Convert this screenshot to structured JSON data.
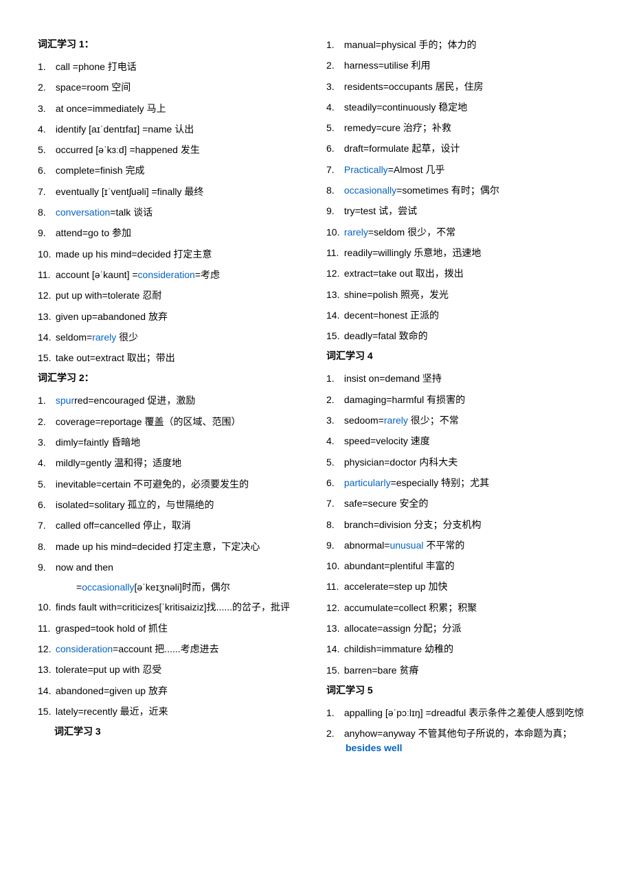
{
  "left": {
    "s1": {
      "title": "词汇学习 1：",
      "items": [
        {
          "n": "1.",
          "parts": [
            {
              "t": "call =phone  打电话"
            }
          ]
        },
        {
          "n": "2.",
          "parts": [
            {
              "t": "space=room 空间"
            }
          ]
        },
        {
          "n": "3.",
          "parts": [
            {
              "t": "at once=immediately  马上"
            }
          ]
        },
        {
          "n": "4.",
          "parts": [
            {
              "t": "identify [aɪˈdentɪfaɪ] =name 认出"
            }
          ]
        },
        {
          "n": "5.",
          "parts": [
            {
              "t": "occurred [əˈkɜːd] =happened 发生"
            }
          ]
        },
        {
          "n": "6.",
          "parts": [
            {
              "t": "complete=finish 完成"
            }
          ]
        },
        {
          "n": "7.",
          "parts": [
            {
              "t": "eventually [ɪˈventʃuəli] =finally 最终"
            }
          ]
        },
        {
          "n": "8.",
          "parts": [
            {
              "t": "conversation",
              "c": "link"
            },
            {
              "t": "=talk 谈话"
            }
          ]
        },
        {
          "n": "9.",
          "parts": [
            {
              "t": "attend=go to 参加"
            }
          ]
        },
        {
          "n": "10.",
          "parts": [
            {
              "t": "made up his mind=decided 打定主意"
            }
          ]
        },
        {
          "n": "11.",
          "parts": [
            {
              "t": "account [əˈkaʊnt] ="
            },
            {
              "t": "consideration",
              "c": "link"
            },
            {
              "t": "=考虑"
            }
          ]
        },
        {
          "n": "12.",
          "parts": [
            {
              "t": "put up with=tolerate 忍耐"
            }
          ]
        },
        {
          "n": "13.",
          "parts": [
            {
              "t": "given up=abandoned 放弃"
            }
          ]
        },
        {
          "n": "14.",
          "parts": [
            {
              "t": "seldom="
            },
            {
              "t": "rarely",
              "c": "link"
            },
            {
              "t": " 很少"
            }
          ]
        },
        {
          "n": "15.",
          "parts": [
            {
              "t": "take out=extract 取出；带出"
            }
          ]
        }
      ]
    },
    "s2": {
      "title": "词汇学习 2：",
      "items": [
        {
          "n": "1.",
          "parts": [
            {
              "t": "spur",
              "c": "link"
            },
            {
              "t": "red=encouraged 促进，激励"
            }
          ]
        },
        {
          "n": "2.",
          "parts": [
            {
              "t": "coverage=reportage 覆盖（的区域、范围）"
            }
          ]
        },
        {
          "n": "3.",
          "parts": [
            {
              "t": "dimly=faintly 昏暗地"
            }
          ]
        },
        {
          "n": "4.",
          "parts": [
            {
              "t": "mildly=gently 温和得；适度地"
            }
          ]
        },
        {
          "n": "5.",
          "parts": [
            {
              "t": "inevitable=certain 不可避免的，必须要发生的"
            }
          ]
        },
        {
          "n": "6.",
          "parts": [
            {
              "t": "isolated=solitary 孤立的，与世隔绝的"
            }
          ]
        },
        {
          "n": "7.",
          "parts": [
            {
              "t": "called off=cancelled 停止，取消"
            }
          ]
        },
        {
          "n": "8.",
          "parts": [
            {
              "t": "made up his mind=decided 打定主意，下定决心"
            }
          ]
        },
        {
          "n": "9.",
          "parts": [
            {
              "t": "now and then"
            }
          ],
          "sub": [
            {
              "t": "=",
              "c": ""
            },
            {
              "t": "occasionally",
              "c": "link"
            },
            {
              "t": "[əˈkeɪʒnəli]时而，偶尔"
            }
          ]
        },
        {
          "n": "10.",
          "parts": [
            {
              "t": "finds fault with=criticizes[ˈkritisaiziz]找......的岔子，批评"
            }
          ]
        },
        {
          "n": "11.",
          "parts": [
            {
              "t": "grasped=took hold of 抓住"
            }
          ]
        },
        {
          "n": "12.",
          "parts": [
            {
              "t": "consideration",
              "c": "link"
            },
            {
              "t": "=account 把......考虑进去"
            }
          ]
        },
        {
          "n": "13.",
          "parts": [
            {
              "t": "tolerate=put up with 忍受"
            }
          ]
        },
        {
          "n": "14.",
          "parts": [
            {
              "t": "abandoned=given up 放弃"
            }
          ]
        },
        {
          "n": "15.",
          "parts": [
            {
              "t": "lately=recently 最近，近来"
            }
          ]
        }
      ]
    },
    "s3": {
      "title": "词汇学习 3"
    }
  },
  "right": {
    "s3items": [
      {
        "n": "1.",
        "parts": [
          {
            "t": "manual=physical 手的；体力的"
          }
        ]
      },
      {
        "n": "2.",
        "parts": [
          {
            "t": "harness=utilise 利用"
          }
        ]
      },
      {
        "n": "3.",
        "parts": [
          {
            "t": "residents=occupants 居民，住房"
          }
        ]
      },
      {
        "n": "4.",
        "parts": [
          {
            "t": "steadily=continuously 稳定地"
          }
        ]
      },
      {
        "n": "5.",
        "parts": [
          {
            "t": "remedy=cure 治疗；补救"
          }
        ]
      },
      {
        "n": "6.",
        "parts": [
          {
            "t": "draft=formulate 起草，设计"
          }
        ]
      },
      {
        "n": "7.",
        "parts": [
          {
            "t": "Practically",
            "c": "link"
          },
          {
            "t": "=Almost 几乎"
          }
        ]
      },
      {
        "n": "8.",
        "parts": [
          {
            "t": "occasionally",
            "c": "link"
          },
          {
            "t": "=sometimes 有时；偶尔"
          }
        ]
      },
      {
        "n": "9.",
        "parts": [
          {
            "t": "try=test 试，尝试"
          }
        ]
      },
      {
        "n": "10.",
        "parts": [
          {
            "t": "rarely",
            "c": "link"
          },
          {
            "t": "=seldom 很少，不常"
          }
        ]
      },
      {
        "n": "11.",
        "parts": [
          {
            "t": "readily=willingly 乐意地，迅速地"
          }
        ]
      },
      {
        "n": "12.",
        "parts": [
          {
            "t": "extract=take out 取出，拨出"
          }
        ]
      },
      {
        "n": "13.",
        "parts": [
          {
            "t": "shine=polish 照亮，发光"
          }
        ]
      },
      {
        "n": "14.",
        "parts": [
          {
            "t": "decent=honest 正派的"
          }
        ]
      },
      {
        "n": "15.",
        "parts": [
          {
            "t": "deadly=fatal 致命的"
          }
        ]
      }
    ],
    "s4": {
      "title": "词汇学习 4",
      "items": [
        {
          "n": "1.",
          "parts": [
            {
              "t": "insist on=demand 坚持"
            }
          ]
        },
        {
          "n": "2.",
          "parts": [
            {
              "t": "damaging=harmful 有损害的"
            }
          ]
        },
        {
          "n": "3.",
          "parts": [
            {
              "t": "sedoom="
            },
            {
              "t": "rarely",
              "c": "link"
            },
            {
              "t": " 很少；不常"
            }
          ]
        },
        {
          "n": "4.",
          "parts": [
            {
              "t": "speed=velocity 速度"
            }
          ]
        },
        {
          "n": "5.",
          "parts": [
            {
              "t": "physician=doctor 内科大夫"
            }
          ]
        },
        {
          "n": "6.",
          "parts": [
            {
              "t": "particularly",
              "c": "link"
            },
            {
              "t": "=especially 特别；尤其"
            }
          ]
        },
        {
          "n": "7.",
          "parts": [
            {
              "t": "safe=secure 安全的"
            }
          ]
        },
        {
          "n": "8.",
          "parts": [
            {
              "t": "branch=division 分支；分支机构"
            }
          ]
        },
        {
          "n": "9.",
          "parts": [
            {
              "t": "abnormal="
            },
            {
              "t": "unusual",
              "c": "link"
            },
            {
              "t": " 不平常的"
            }
          ]
        },
        {
          "n": "10.",
          "parts": [
            {
              "t": "abundant=plentiful 丰富的"
            }
          ]
        },
        {
          "n": "11.",
          "parts": [
            {
              "t": "accelerate=step up 加快"
            }
          ]
        },
        {
          "n": "12.",
          "parts": [
            {
              "t": "accumulate=collect 积累；积聚"
            }
          ]
        },
        {
          "n": "13.",
          "parts": [
            {
              "t": "allocate=assign 分配；分派"
            }
          ]
        },
        {
          "n": "14.",
          "parts": [
            {
              "t": "childish=immature 幼稚的"
            }
          ]
        },
        {
          "n": "15.",
          "parts": [
            {
              "t": "barren=bare 贫瘠"
            }
          ]
        }
      ]
    },
    "s5": {
      "title": "词汇学习 5",
      "items": [
        {
          "n": "1.",
          "parts": [
            {
              "t": "appalling [əˈpɔːlɪŋ] =dreadful 表示条件之差使人感到吃惊"
            }
          ]
        },
        {
          "n": "2.",
          "parts": [
            {
              "t": "anyhow=anyway 不管其他句子所说的，本命题为真；"
            },
            {
              "t": "besides well",
              "c": "link bold"
            }
          ]
        }
      ]
    }
  }
}
